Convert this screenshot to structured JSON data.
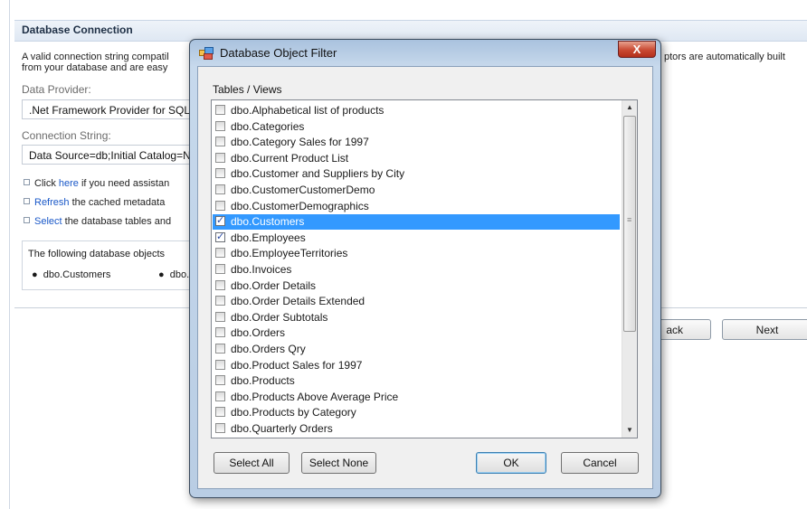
{
  "page": {
    "header": "Database Connection",
    "description": "A valid connection string compatible with the selected data provider is required to generate the project. Data entity descriptors are automatically built from your database and are easy to customize.",
    "description_line1": "A valid connection string compatil",
    "description_line2": "from your database and are easy",
    "description_right": "ptors are automatically built",
    "data_provider_label": "Data Provider:",
    "data_provider_value": ".Net Framework Provider for SQL Server",
    "connection_string_label": "Connection String:",
    "connection_string_value": "Data Source=db;Initial Catalog=Northwind",
    "hints": [
      {
        "prefix": "Click ",
        "link": "here",
        "suffix": " if you need assistan"
      },
      {
        "prefix": "",
        "link": "Refresh",
        "suffix": " the cached metadata"
      },
      {
        "prefix": "",
        "link": "Select",
        "suffix": " the database tables and"
      }
    ],
    "objects_text": "The following database objects",
    "objects": [
      "dbo.Customers",
      "dbo.Employees"
    ],
    "back_label": "ack",
    "next_label": "Next"
  },
  "dialog": {
    "title": "Database Object Filter",
    "close_glyph": "X",
    "list_label": "Tables / Views",
    "items": [
      {
        "name": "dbo.Alphabetical list of products",
        "checked": false,
        "selected": false
      },
      {
        "name": "dbo.Categories",
        "checked": false,
        "selected": false
      },
      {
        "name": "dbo.Category Sales for 1997",
        "checked": false,
        "selected": false
      },
      {
        "name": "dbo.Current Product List",
        "checked": false,
        "selected": false
      },
      {
        "name": "dbo.Customer and Suppliers by City",
        "checked": false,
        "selected": false
      },
      {
        "name": "dbo.CustomerCustomerDemo",
        "checked": false,
        "selected": false
      },
      {
        "name": "dbo.CustomerDemographics",
        "checked": false,
        "selected": false
      },
      {
        "name": "dbo.Customers",
        "checked": true,
        "selected": true
      },
      {
        "name": "dbo.Employees",
        "checked": true,
        "selected": false
      },
      {
        "name": "dbo.EmployeeTerritories",
        "checked": false,
        "selected": false
      },
      {
        "name": "dbo.Invoices",
        "checked": false,
        "selected": false
      },
      {
        "name": "dbo.Order Details",
        "checked": false,
        "selected": false
      },
      {
        "name": "dbo.Order Details Extended",
        "checked": false,
        "selected": false
      },
      {
        "name": "dbo.Order Subtotals",
        "checked": false,
        "selected": false
      },
      {
        "name": "dbo.Orders",
        "checked": false,
        "selected": false
      },
      {
        "name": "dbo.Orders Qry",
        "checked": false,
        "selected": false
      },
      {
        "name": "dbo.Product Sales for 1997",
        "checked": false,
        "selected": false
      },
      {
        "name": "dbo.Products",
        "checked": false,
        "selected": false
      },
      {
        "name": "dbo.Products Above Average Price",
        "checked": false,
        "selected": false
      },
      {
        "name": "dbo.Products by Category",
        "checked": false,
        "selected": false
      },
      {
        "name": "dbo.Quarterly Orders",
        "checked": false,
        "selected": false
      }
    ],
    "buttons": {
      "select_all": "Select All",
      "select_none": "Select None",
      "ok": "OK",
      "cancel": "Cancel"
    }
  },
  "icons": {
    "dialog_icon": "window-filter-icon",
    "close": "close-icon",
    "scroll_up": "scroll-up-arrow-icon",
    "scroll_down": "scroll-down-arrow-icon",
    "bullet": "bullet-square-icon"
  },
  "colors": {
    "selection": "#3399ff",
    "link": "#1a58c8",
    "close_button": "#c94a33"
  }
}
